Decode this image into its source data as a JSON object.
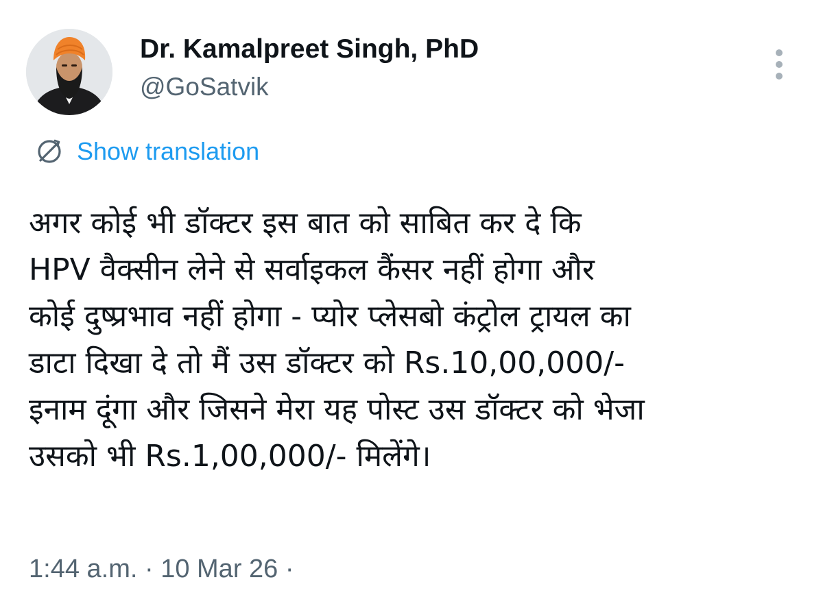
{
  "author": {
    "display_name": "Dr. Kamalpreet Singh, PhD",
    "handle": "@GoSatvik",
    "avatar_icon": "profile-photo"
  },
  "actions": {
    "more_icon": "more-vertical-icon"
  },
  "translation": {
    "icon": "globe-translate-icon",
    "label": "Show translation"
  },
  "tweet": {
    "lines": [
      "अगर कोई भी डॉक्टर इस बात को साबित कर दे कि",
      "HPV वैक्सीन लेने से सर्वाइकल कैंसर नहीं होगा और",
      "कोई दुष्प्रभाव नहीं होगा - प्योर प्लेसबो कंट्रोल ट्रायल का",
      "डाटा दिखा दे तो मैं उस डॉक्टर को Rs.10,00,000/-",
      "इनाम दूंगा और जिसने मेरा यह पोस्ट उस डॉक्टर को भेजा",
      "उसको भी Rs.1,00,000/- मिलेंगे।"
    ]
  },
  "meta": {
    "time": "1:44 a.m.",
    "separator": "·",
    "date": "10 Mar 26",
    "trailing_separator": "·"
  },
  "colors": {
    "text": "#0f1419",
    "secondary": "#536471",
    "link": "#1d9bf0",
    "turban": "#f0822a",
    "background": "#ffffff"
  }
}
